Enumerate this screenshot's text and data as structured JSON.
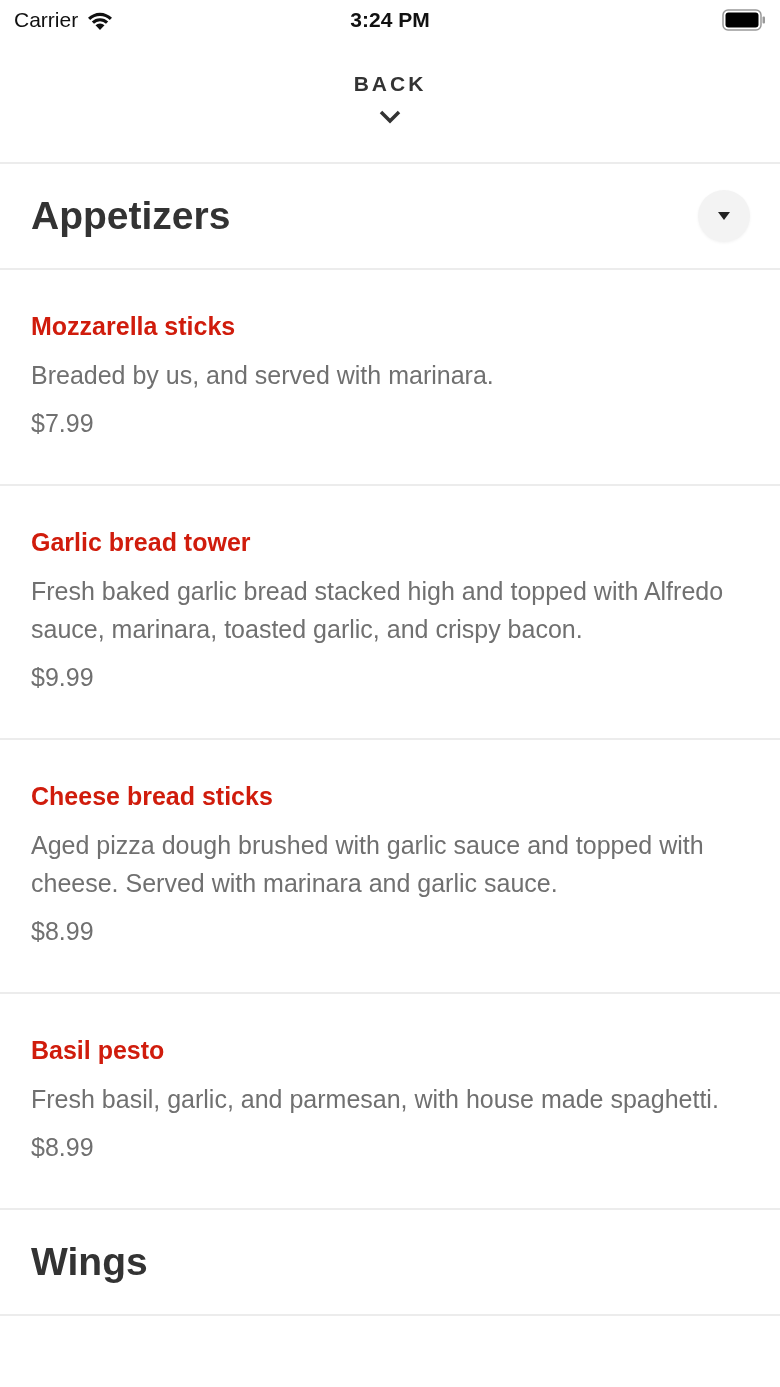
{
  "status_bar": {
    "carrier": "Carrier",
    "time": "3:24 PM"
  },
  "back_button": {
    "label": "BACK"
  },
  "sections": [
    {
      "title": "Appetizers",
      "toggle": true,
      "items": [
        {
          "name": "Mozzarella sticks",
          "description": "Breaded by us, and served with marinara.",
          "price": "$7.99"
        },
        {
          "name": "Garlic bread tower",
          "description": "Fresh baked garlic bread stacked high and topped with Alfredo sauce, marinara, toasted garlic, and crispy bacon.",
          "price": "$9.99"
        },
        {
          "name": "Cheese bread sticks",
          "description": "Aged pizza dough brushed with garlic sauce and topped with cheese. Served with marinara and garlic sauce.",
          "price": "$8.99"
        },
        {
          "name": "Basil pesto",
          "description": "Fresh basil, garlic, and parmesan, with house made spaghetti.",
          "price": "$8.99"
        }
      ]
    },
    {
      "title": "Wings",
      "toggle": false
    }
  ]
}
